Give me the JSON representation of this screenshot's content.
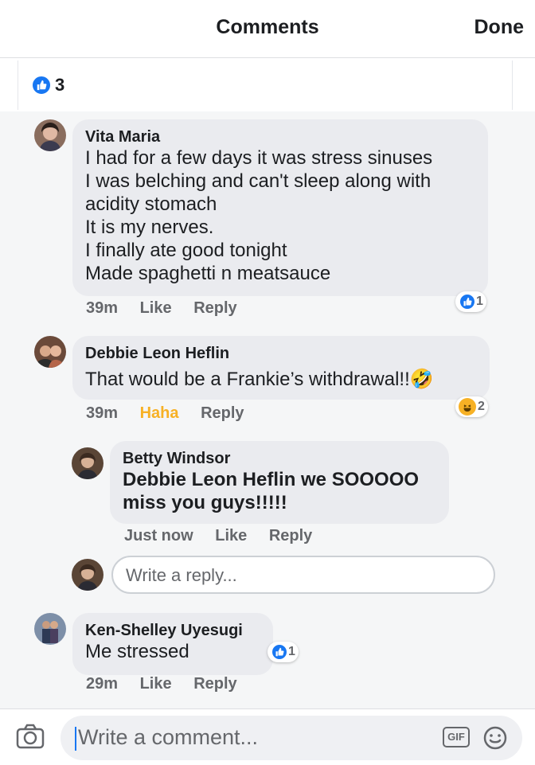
{
  "header": {
    "title": "Comments",
    "done_label": "Done"
  },
  "likes_summary": {
    "count": "3",
    "icon": "like-icon"
  },
  "comments": [
    {
      "author": "Vita Maria",
      "lines": [
        "I had for a few days it was stress sinuses",
        "I was belching and can't sleep along with",
        "acidity stomach",
        "It is my nerves.",
        "I finally ate good tonight",
        "Made spaghetti n meatsauce"
      ],
      "time": "39m",
      "like_label": "Like",
      "reply_label": "Reply",
      "reaction": {
        "icon": "like-icon",
        "count": "1"
      }
    },
    {
      "author": "Debbie Leon Heflin",
      "text": "That would be a Frankie’s withdrawal!!",
      "emoji": "🤣",
      "time": "39m",
      "like_label": "Haha",
      "reply_label": "Reply",
      "reaction": {
        "icon": "haha-icon",
        "count": "2"
      }
    },
    {
      "author": "Betty Windsor",
      "line1": "Debbie Leon Heflin we SOOOOO",
      "line2": "miss you guys!!!!!",
      "time": "Just now",
      "like_label": "Like",
      "reply_label": "Reply"
    },
    {
      "author": "Ken-Shelley Uyesugi",
      "text": "Me stressed",
      "time": "29m",
      "like_label": "Like",
      "reply_label": "Reply",
      "reaction": {
        "icon": "like-icon",
        "count": "1"
      }
    }
  ],
  "reply_input": {
    "placeholder": "Write a reply..."
  },
  "comment_input": {
    "placeholder": "Write a comment...",
    "gif_label": "GIF"
  },
  "colors": {
    "accent": "#1877f2",
    "haha": "#f7b125",
    "bubble": "#eaebef"
  }
}
